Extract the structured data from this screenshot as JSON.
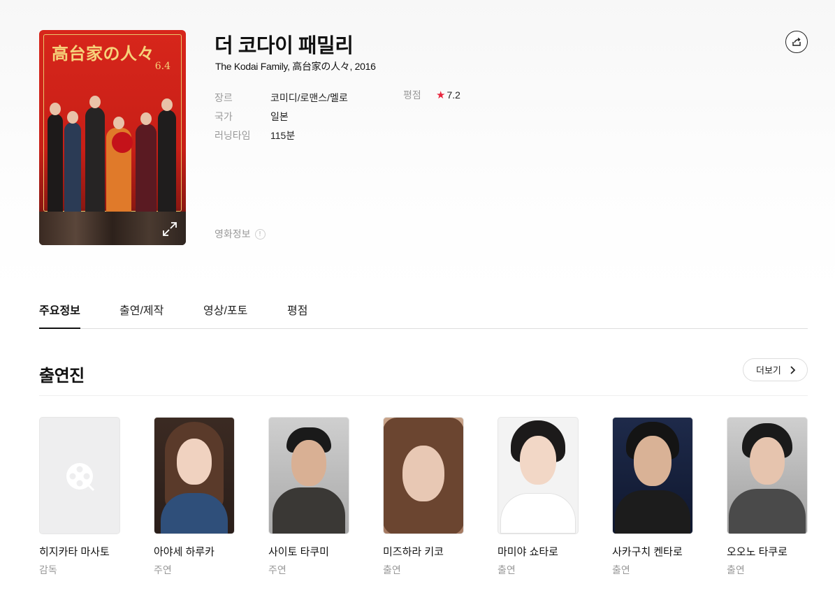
{
  "movie": {
    "title": "더 코다이 패밀리",
    "subtitle": "The Kodai Family, 高台家の人々, 2016",
    "poster": {
      "title_text": "高台家の人々",
      "date_text": "6.4"
    },
    "meta": [
      {
        "key": "장르",
        "value": "코미디/로맨스/멜로"
      },
      {
        "key": "국가",
        "value": "일본"
      },
      {
        "key": "러닝타임",
        "value": "115분"
      }
    ],
    "rating": {
      "key": "평점",
      "value": "7.2",
      "star": "★"
    },
    "info_link": "영화정보",
    "info_icon": "!"
  },
  "tabs": [
    {
      "label": "주요정보",
      "active": true
    },
    {
      "label": "출연/제작",
      "active": false
    },
    {
      "label": "영상/포토",
      "active": false
    },
    {
      "label": "평점",
      "active": false
    }
  ],
  "cast_section": {
    "title": "출연진",
    "more_label": "더보기"
  },
  "cast": [
    {
      "name": "히지카타 마사토",
      "role": "감독"
    },
    {
      "name": "아야세 하루카",
      "role": "주연"
    },
    {
      "name": "사이토 타쿠미",
      "role": "주연"
    },
    {
      "name": "미즈하라 키코",
      "role": "출연"
    },
    {
      "name": "마미야 쇼타로",
      "role": "출연"
    },
    {
      "name": "사카구치 켄타로",
      "role": "출연"
    },
    {
      "name": "오오노 타쿠로",
      "role": "출연"
    }
  ],
  "icons": {
    "share": "share-icon",
    "expand": "expand-icon",
    "chevron": "chevron-right-icon",
    "placeholder": "film-reel-icon"
  },
  "colors": {
    "accent_star": "#e8253d",
    "poster_red": "#d7261b",
    "muted_text": "#999999"
  }
}
